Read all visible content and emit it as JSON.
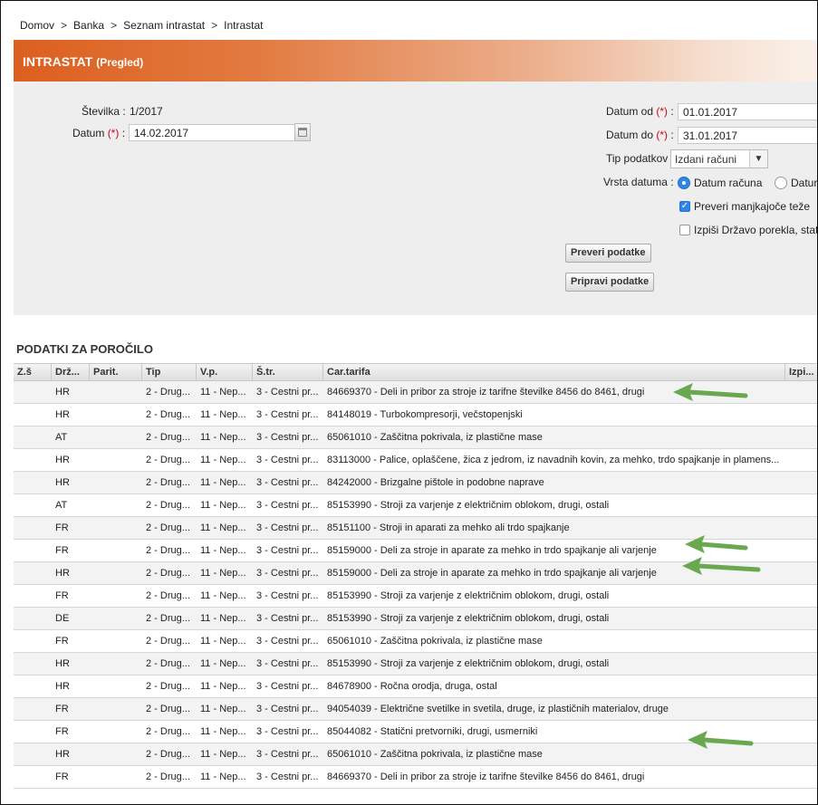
{
  "breadcrumb": [
    "Domov",
    "Banka",
    "Seznam intrastat",
    "Intrastat"
  ],
  "breadcrumb_sep": ">",
  "title": "INTRASTAT",
  "subtitle": "(Pregled)",
  "form": {
    "stevilka_label": "Številka :",
    "stevilka_value": "1/2017",
    "datum_label": "Datum",
    "datum_value": "14.02.2017",
    "required_mark": "(*)",
    "colon": ":",
    "datum_od_label": "Datum od",
    "datum_od_value": "01.01.2017",
    "datum_do_label": "Datum do",
    "datum_do_value": "31.01.2017",
    "tip_podatkov_label": "Tip podatkov :",
    "tip_podatkov_value": "Izdani računi",
    "vrsta_datuma_label": "Vrsta datuma :",
    "radio_datum_racuna": "Datum računa",
    "radio_datum_other": "Datur",
    "check_preveri": "Preveri manjkajoče teže",
    "check_izpisi": "Izpiši Državo porekla, stat",
    "btn_preveri": "Preveri podatke",
    "btn_pripravi": "Pripravi podatke"
  },
  "section_title": "PODATKI ZA POROČILO",
  "table": {
    "columns": [
      "Z.š",
      "Drž...",
      "Parit.",
      "Tip",
      "V.p.",
      "Š.tr.",
      "Car.tarifa",
      "Izpi..."
    ],
    "rows": [
      [
        "",
        "HR",
        "",
        "2 - Drug...",
        "11 - Nep...",
        "3 - Cestni pr...",
        "84669370 - Deli in pribor za stroje iz tarifne številke 8456 do 8461, drugi",
        ""
      ],
      [
        "",
        "HR",
        "",
        "2 - Drug...",
        "11 - Nep...",
        "3 - Cestni pr...",
        "84148019 - Turbokompresorji, večstopenjski",
        ""
      ],
      [
        "",
        "AT",
        "",
        "2 - Drug...",
        "11 - Nep...",
        "3 - Cestni pr...",
        "65061010 - Zaščitna pokrivala, iz plastične mase",
        ""
      ],
      [
        "",
        "HR",
        "",
        "2 - Drug...",
        "11 - Nep...",
        "3 - Cestni pr...",
        "83113000 - Palice, oplaščene, žica z jedrom, iz navadnih kovin, za mehko, trdo spajkanje in plamens...",
        ""
      ],
      [
        "",
        "HR",
        "",
        "2 - Drug...",
        "11 - Nep...",
        "3 - Cestni pr...",
        "84242000 - Brizgalne pištole in podobne naprave",
        ""
      ],
      [
        "",
        "AT",
        "",
        "2 - Drug...",
        "11 - Nep...",
        "3 - Cestni pr...",
        "85153990 - Stroji za varjenje z električnim oblokom, drugi, ostali",
        ""
      ],
      [
        "",
        "FR",
        "",
        "2 - Drug...",
        "11 - Nep...",
        "3 - Cestni pr...",
        "85151100 - Stroji in aparati za mehko ali trdo spajkanje",
        ""
      ],
      [
        "",
        "FR",
        "",
        "2 - Drug...",
        "11 - Nep...",
        "3 - Cestni pr...",
        "85159000 - Deli za stroje in aparate za mehko in trdo spajkanje ali varjenje",
        ""
      ],
      [
        "",
        "HR",
        "",
        "2 - Drug...",
        "11 - Nep...",
        "3 - Cestni pr...",
        "85159000 - Deli za stroje in aparate za mehko in trdo spajkanje ali varjenje",
        ""
      ],
      [
        "",
        "FR",
        "",
        "2 - Drug...",
        "11 - Nep...",
        "3 - Cestni pr...",
        "85153990 - Stroji za varjenje z električnim oblokom, drugi, ostali",
        ""
      ],
      [
        "",
        "DE",
        "",
        "2 - Drug...",
        "11 - Nep...",
        "3 - Cestni pr...",
        "85153990 - Stroji za varjenje z električnim oblokom, drugi, ostali",
        ""
      ],
      [
        "",
        "FR",
        "",
        "2 - Drug...",
        "11 - Nep...",
        "3 - Cestni pr...",
        "65061010 - Zaščitna pokrivala, iz plastične mase",
        ""
      ],
      [
        "",
        "HR",
        "",
        "2 - Drug...",
        "11 - Nep...",
        "3 - Cestni pr...",
        "85153990 - Stroji za varjenje z električnim oblokom, drugi, ostali",
        ""
      ],
      [
        "",
        "HR",
        "",
        "2 - Drug...",
        "11 - Nep...",
        "3 - Cestni pr...",
        "84678900 - Ročna orodja, druga, ostal",
        ""
      ],
      [
        "",
        "FR",
        "",
        "2 - Drug...",
        "11 - Nep...",
        "3 - Cestni pr...",
        "94054039 - Električne svetilke in svetila, druge, iz plastičnih materialov, druge",
        ""
      ],
      [
        "",
        "FR",
        "",
        "2 - Drug...",
        "11 - Nep...",
        "3 - Cestni pr...",
        "85044082 - Statični pretvorniki, drugi, usmerniki",
        ""
      ],
      [
        "",
        "HR",
        "",
        "2 - Drug...",
        "11 - Nep...",
        "3 - Cestni pr...",
        "65061010 - Zaščitna pokrivala, iz plastične mase",
        ""
      ],
      [
        "",
        "FR",
        "",
        "2 - Drug...",
        "11 - Nep...",
        "3 - Cestni pr...",
        "84669370 - Deli in pribor za stroje iz tarifne številke 8456 do 8461, drugi",
        ""
      ]
    ]
  },
  "annotation_arrow_rows": [
    0,
    7,
    8,
    16
  ],
  "colors": {
    "title_gradient_start": "#dc5f1f",
    "arrow_green": "#6aa84f",
    "required": "#d0021b",
    "accent_blue": "#2d87e8"
  }
}
